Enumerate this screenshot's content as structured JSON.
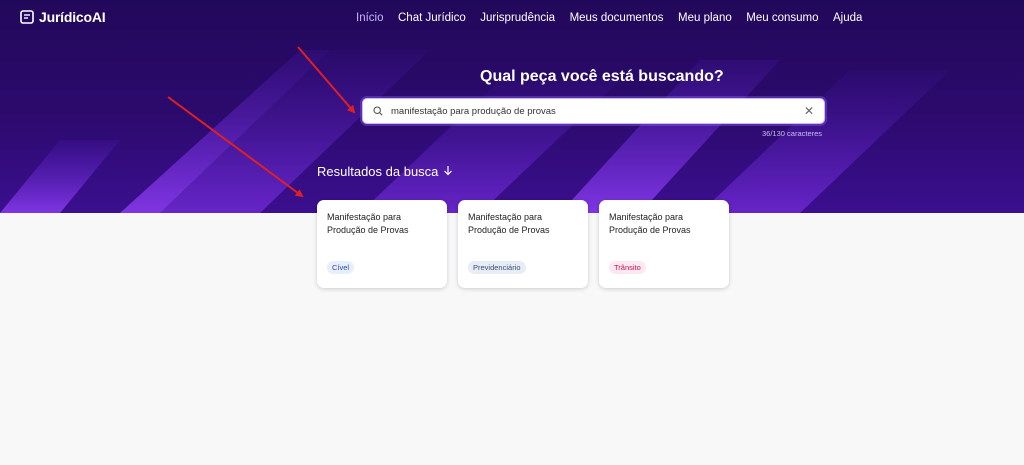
{
  "app": {
    "name": "JurídicoAI"
  },
  "nav": [
    {
      "label": "Início",
      "active": true
    },
    {
      "label": "Chat Jurídico",
      "active": false
    },
    {
      "label": "Jurisprudência",
      "active": false
    },
    {
      "label": "Meus documentos",
      "active": false
    },
    {
      "label": "Meu plano",
      "active": false
    },
    {
      "label": "Meu consumo",
      "active": false
    },
    {
      "label": "Ajuda",
      "active": false
    }
  ],
  "hero": {
    "headline": "Qual peça você está buscando?"
  },
  "search": {
    "value": "manifestação para produção de provas",
    "char_count": "36/130 caracteres"
  },
  "results": {
    "title": "Resultados da busca",
    "cards": [
      {
        "title": "Manifestação para Produção de Provas",
        "tag": "Cível"
      },
      {
        "title": "Manifestação para Produção de Provas",
        "tag": "Previdenciário"
      },
      {
        "title": "Manifestação para Produção de Provas",
        "tag": "Trânsito"
      }
    ]
  },
  "colors": {
    "accent": "#7c3aed",
    "hero_bg": "#2a0a6b",
    "arrow": "#e02020"
  }
}
